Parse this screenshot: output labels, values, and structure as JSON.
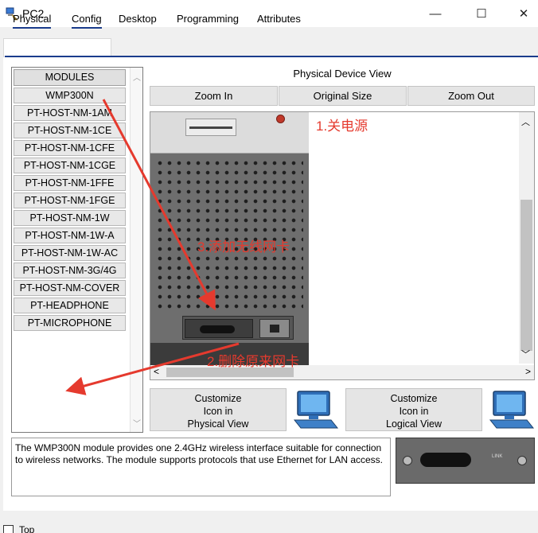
{
  "window": {
    "title": "PC2",
    "minimize_glyph": "—",
    "maximize_glyph": "☐",
    "close_glyph": "✕"
  },
  "tabs": [
    {
      "label": "Physical",
      "active": true
    },
    {
      "label": "Config"
    },
    {
      "label": "Desktop"
    },
    {
      "label": "Programming"
    },
    {
      "label": "Attributes"
    }
  ],
  "modules": {
    "header": "MODULES",
    "items": [
      "WMP300N",
      "PT-HOST-NM-1AM",
      "PT-HOST-NM-1CE",
      "PT-HOST-NM-1CFE",
      "PT-HOST-NM-1CGE",
      "PT-HOST-NM-1FFE",
      "PT-HOST-NM-1FGE",
      "PT-HOST-NM-1W",
      "PT-HOST-NM-1W-A",
      "PT-HOST-NM-1W-AC",
      "PT-HOST-NM-3G/4G",
      "PT-HOST-NM-COVER",
      "PT-HEADPHONE",
      "PT-MICROPHONE"
    ]
  },
  "device_view": {
    "title": "Physical Device View",
    "zoom_in": "Zoom In",
    "original_size": "Original Size",
    "zoom_out": "Zoom Out"
  },
  "annotations": {
    "step1": "1.关电源",
    "step2": "2.删除原来网卡",
    "step3": "3.添加无线网卡",
    "color": "#e53a2e"
  },
  "customize": {
    "physical": [
      "Customize",
      "Icon in",
      "Physical View"
    ],
    "logical": [
      "Customize",
      "Icon in",
      "Logical View"
    ]
  },
  "description": "The WMP300N module provides one 2.4GHz wireless interface suitable for connection to wireless networks. The module supports protocols that use Ethernet for LAN access.",
  "module_image_label": "LINK",
  "bottom": {
    "top_label": "Top",
    "top_checked": false
  },
  "icons": {
    "app": "packet-tracer-pc-icon",
    "pc": "pc-monitor-icon"
  }
}
